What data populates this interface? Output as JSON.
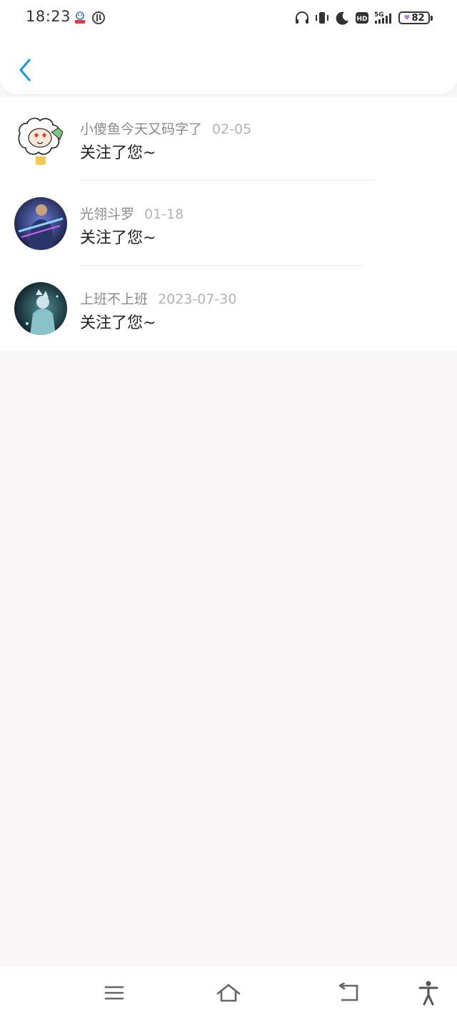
{
  "status_bar": {
    "time": "18:23",
    "battery": "82",
    "icons": [
      "app-icon",
      "app-icon-2",
      "headphones-icon",
      "vibrate-icon",
      "moon-icon",
      "hd-icon",
      "signal-5g-icon",
      "battery-icon"
    ]
  },
  "header": {
    "back_icon": "chevron-left-icon",
    "accent_color": "#1a9be8"
  },
  "notifications": [
    {
      "username": "小傻鱼今天又码字了",
      "date": "02-05",
      "message": "关注了您~"
    },
    {
      "username": "光翎斗罗",
      "date": "01-18",
      "message": "关注了您~"
    },
    {
      "username": "上班不上班",
      "date": "2023-07-30",
      "message": "关注了您~"
    }
  ],
  "nav_bar": {
    "icons": [
      "menu-icon",
      "home-icon",
      "back-icon",
      "accessibility-icon"
    ]
  }
}
